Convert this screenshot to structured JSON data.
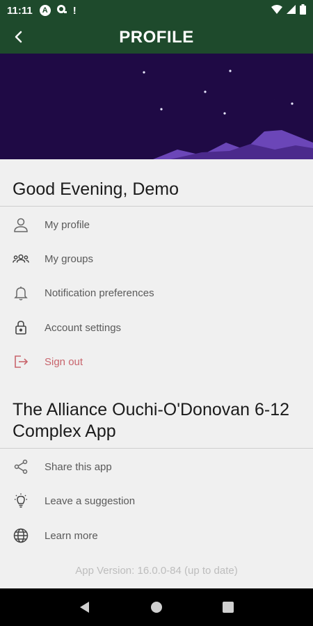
{
  "status_bar": {
    "time": "11:11",
    "a_icon_letter": "A",
    "alert": "!"
  },
  "header": {
    "title": "PROFILE"
  },
  "greeting": "Good Evening, Demo",
  "account_menu": [
    {
      "label": "My profile",
      "icon": "person-icon"
    },
    {
      "label": "My groups",
      "icon": "group-icon"
    },
    {
      "label": "Notification preferences",
      "icon": "bell-icon"
    },
    {
      "label": "Account settings",
      "icon": "lock-icon"
    },
    {
      "label": "Sign out",
      "icon": "sign-out-icon"
    }
  ],
  "app_name": "The Alliance Ouchi-O'Donovan 6-12 Complex App",
  "app_menu": [
    {
      "label": "Share this app",
      "icon": "share-icon"
    },
    {
      "label": "Leave a suggestion",
      "icon": "lightbulb-icon"
    },
    {
      "label": "Learn more",
      "icon": "globe-icon"
    }
  ],
  "app_version": "App Version: 16.0.0-84 (up to date)",
  "colors": {
    "header_bg": "#1e4a2c",
    "banner_bg": "#1f0a45",
    "sign_out": "#c8646c"
  }
}
